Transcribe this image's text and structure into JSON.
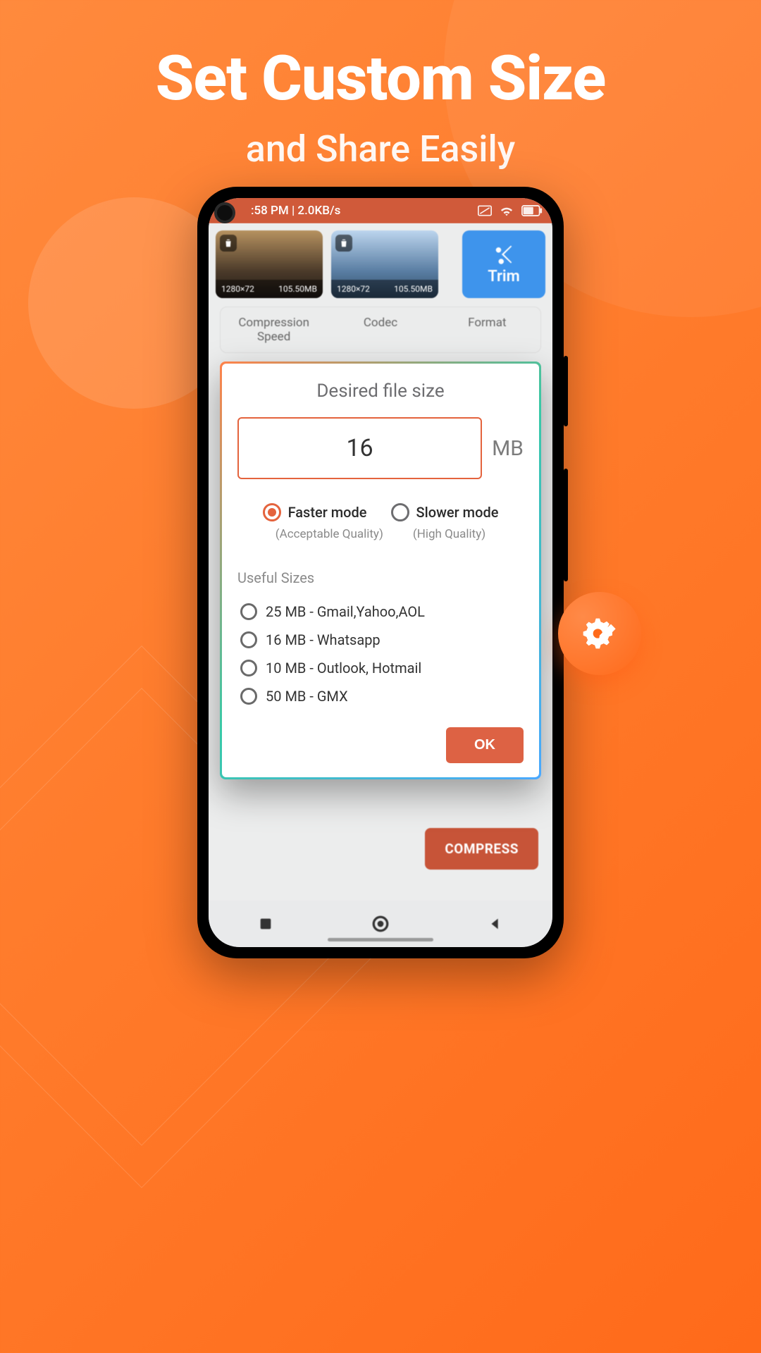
{
  "page": {
    "heroTitle": "Set Custom Size",
    "heroSubtitle": "and Share Easily"
  },
  "status": {
    "time": ":58 PM | 2.0KB/s"
  },
  "thumbs": [
    {
      "resolution": "1280×72",
      "size": "105.50MB"
    },
    {
      "resolution": "1280×72",
      "size": "105.50MB"
    }
  ],
  "trim": {
    "label": "Trim"
  },
  "optionTabs": {
    "speed": "Compression\nSpeed",
    "codec": "Codec",
    "format": "Format"
  },
  "modal": {
    "title": "Desired file size",
    "value": "16",
    "unit": "MB",
    "mode": {
      "faster": "Faster mode",
      "fasterSub": "(Acceptable Quality)",
      "slower": "Slower mode",
      "slowerSub": "(High Quality)"
    },
    "usefulHeader": "Useful Sizes",
    "useful": [
      "25 MB - Gmail,Yahoo,AOL",
      "16 MB - Whatsapp",
      "10 MB - Outlook, Hotmail",
      "50 MB - GMX"
    ],
    "ok": "OK"
  },
  "compress": {
    "label": "COMPRESS"
  }
}
